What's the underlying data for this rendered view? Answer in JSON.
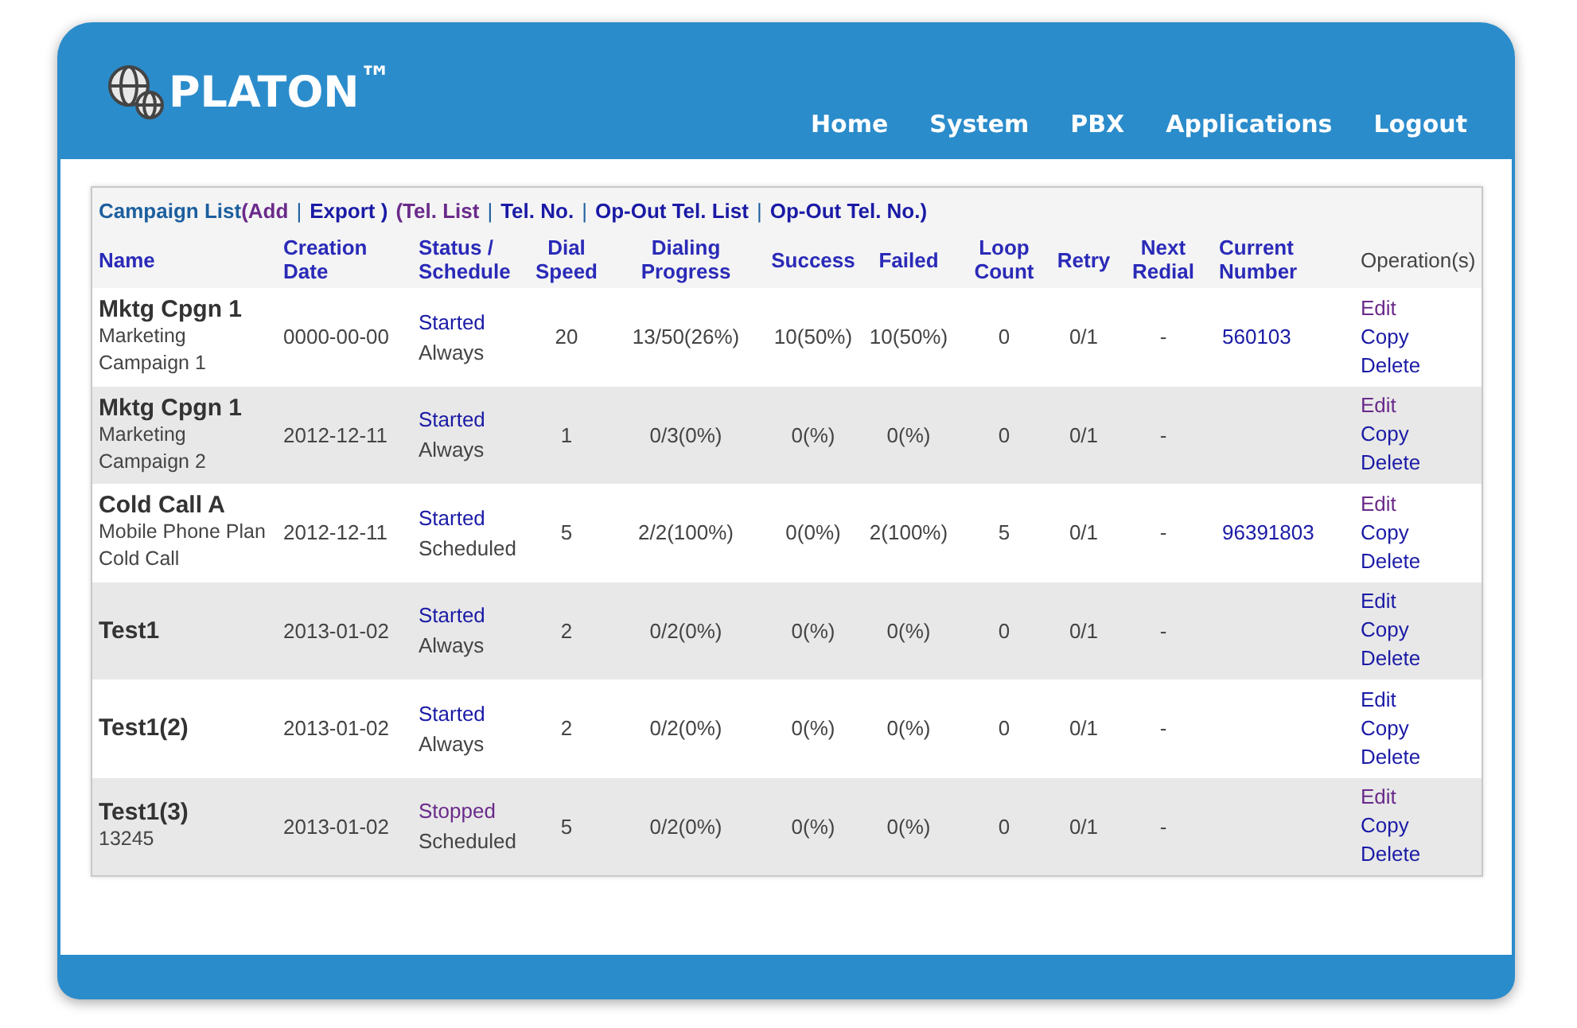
{
  "logo": {
    "text": "PLATON$^{™}$"
  },
  "nav": [
    {
      "label": "Home"
    },
    {
      "label": "System"
    },
    {
      "label": "PBX"
    },
    {
      "label": "Applications"
    },
    {
      "label": "Logout"
    }
  ],
  "toolbar": [
    {
      "kind": "label",
      "text": "Campaign List"
    },
    {
      "kind": "link",
      "text": "(Add",
      "visited": true
    },
    {
      "kind": "separator",
      "text": "|"
    },
    {
      "kind": "link",
      "text": "Export )",
      "visited": false
    },
    {
      "kind": "link",
      "text": "(Tel. List",
      "visited": true
    },
    {
      "kind": "separator",
      "text": "|"
    },
    {
      "kind": "link",
      "text": "Tel. No.",
      "visited": false
    },
    {
      "kind": "separator",
      "text": "|"
    },
    {
      "kind": "link",
      "text": "Op-Out Tel. List",
      "visited": false
    },
    {
      "kind": "separator",
      "text": "|"
    },
    {
      "kind": "link",
      "text": "Op-Out Tel. No.)",
      "visited": false
    }
  ],
  "table": {
    "columns": [
      "Name",
      "Creation Date",
      "Status / Schedule",
      "Dial Speed",
      "Dialing Progress",
      "Success",
      "Failed",
      "Loop Count",
      "Retry",
      "Next Redial",
      "Current Number",
      "Operation(s)"
    ],
    "rows": [
      {
        "name": "Mktg Cpgn 1",
        "description": "Marketing Campaign 1",
        "date": "0000-00-00",
        "status": {
          "text": "Started",
          "kind": "started"
        },
        "schedule": "Always",
        "dial_speed": "20",
        "progress": "13/50(26%)",
        "success": "10(50%)",
        "failed": "10(50%)",
        "loop_count": "0",
        "retry": "0/1",
        "next_redial": "-",
        "current_number": "560103",
        "operations": [
          {
            "label": "Edit",
            "visited": true
          },
          {
            "label": "Copy",
            "visited": false
          },
          {
            "label": "Delete",
            "visited": false
          }
        ]
      },
      {
        "name": "Mktg Cpgn 1",
        "description": "Marketing Campaign 2",
        "date": "2012-12-11",
        "status": {
          "text": "Started",
          "kind": "started"
        },
        "schedule": "Always",
        "dial_speed": "1",
        "progress": "0/3(0%)",
        "success": "0(%)",
        "failed": "0(%)",
        "loop_count": "0",
        "retry": "0/1",
        "next_redial": "-",
        "operations": [
          {
            "label": "Edit",
            "visited": true
          },
          {
            "label": "Copy",
            "visited": false
          },
          {
            "label": "Delete",
            "visited": false
          }
        ]
      },
      {
        "name": "Cold Call A",
        "description": "Mobile Phone Plan Cold Call",
        "date": "2012-12-11",
        "status": {
          "text": "Started",
          "kind": "started"
        },
        "schedule": "Scheduled",
        "dial_speed": "5",
        "progress": "2/2(100%)",
        "success": "0(0%)",
        "failed": "2(100%)",
        "loop_count": "5",
        "retry": "0/1",
        "next_redial": "-",
        "current_number": "96391803",
        "operations": [
          {
            "label": "Edit",
            "visited": true
          },
          {
            "label": "Copy",
            "visited": false
          },
          {
            "label": "Delete",
            "visited": false
          }
        ]
      },
      {
        "name": "Test1",
        "date": "2013-01-02",
        "status": {
          "text": "Started",
          "kind": "started"
        },
        "schedule": "Always",
        "dial_speed": "2",
        "progress": "0/2(0%)",
        "success": "0(%)",
        "failed": "0(%)",
        "loop_count": "0",
        "retry": "0/1",
        "next_redial": "-",
        "operations": [
          {
            "label": "Edit",
            "visited": false
          },
          {
            "label": "Copy",
            "visited": false
          },
          {
            "label": "Delete",
            "visited": false
          }
        ]
      },
      {
        "name": "Test1(2)",
        "date": "2013-01-02",
        "status": {
          "text": "Started",
          "kind": "started"
        },
        "schedule": "Always",
        "dial_speed": "2",
        "progress": "0/2(0%)",
        "success": "0(%)",
        "failed": "0(%)",
        "loop_count": "0",
        "retry": "0/1",
        "next_redial": "-",
        "operations": [
          {
            "label": "Edit",
            "visited": false
          },
          {
            "label": "Copy",
            "visited": false
          },
          {
            "label": "Delete",
            "visited": false
          }
        ]
      },
      {
        "name": "Test1(3)",
        "description": "13245",
        "date": "2013-01-02",
        "status": {
          "text": "Stopped",
          "kind": "stopped"
        },
        "schedule": "Scheduled",
        "dial_speed": "5",
        "progress": "0/2(0%)",
        "success": "0(%)",
        "failed": "0(%)",
        "loop_count": "0",
        "retry": "0/1",
        "next_redial": "-",
        "operations": [
          {
            "label": "Edit",
            "visited": true
          },
          {
            "label": "Copy",
            "visited": false
          },
          {
            "label": "Delete",
            "visited": false
          }
        ]
      }
    ]
  }
}
